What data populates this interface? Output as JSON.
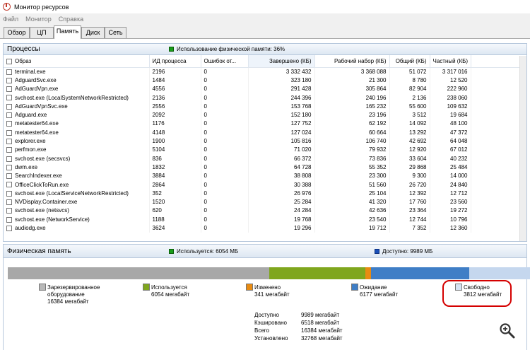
{
  "window": {
    "title": "Монитор ресурсов"
  },
  "menu": [
    "Файл",
    "Монитор",
    "Справка"
  ],
  "tabs": [
    "Обзор",
    "ЦП",
    "Память",
    "Диск",
    "Сеть"
  ],
  "processes": {
    "title": "Процессы",
    "usage_label": "Использование физической памяти: 36%",
    "columns": [
      "Образ",
      "ИД процесса",
      "Ошибок от...",
      "Завершено (КБ)",
      "Рабочий набор (КБ)",
      "Общий (КБ)",
      "Частный (КБ)"
    ],
    "rows": [
      [
        "terminal.exe",
        "2196",
        "0",
        "3 332 432",
        "3 368 088",
        "51 072",
        "3 317 016"
      ],
      [
        "AdguardSvc.exe",
        "1484",
        "0",
        "323 180",
        "21 300",
        "8 780",
        "12 520"
      ],
      [
        "AdGuardVpn.exe",
        "4556",
        "0",
        "291 428",
        "305 864",
        "82 904",
        "222 960"
      ],
      [
        "svchost.exe (LocalSystemNetworkRestricted)",
        "2136",
        "0",
        "244 396",
        "240 196",
        "2 136",
        "238 060"
      ],
      [
        "AdGuardVpnSvc.exe",
        "2556",
        "0",
        "153 768",
        "165 232",
        "55 600",
        "109 632"
      ],
      [
        "Adguard.exe",
        "2092",
        "0",
        "152 180",
        "23 196",
        "3 512",
        "19 684"
      ],
      [
        "metatester64.exe",
        "1176",
        "0",
        "127 752",
        "62 192",
        "14 092",
        "48 100"
      ],
      [
        "metatester64.exe",
        "4148",
        "0",
        "127 024",
        "60 664",
        "13 292",
        "47 372"
      ],
      [
        "explorer.exe",
        "1900",
        "0",
        "105 816",
        "106 740",
        "42 692",
        "64 048"
      ],
      [
        "perfmon.exe",
        "5104",
        "0",
        "71 020",
        "79 932",
        "12 920",
        "67 012"
      ],
      [
        "svchost.exe (secsvcs)",
        "836",
        "0",
        "66 372",
        "73 836",
        "33 604",
        "40 232"
      ],
      [
        "dwm.exe",
        "1832",
        "0",
        "64 728",
        "55 352",
        "29 868",
        "25 484"
      ],
      [
        "SearchIndexer.exe",
        "3884",
        "0",
        "38 808",
        "23 300",
        "9 300",
        "14 000"
      ],
      [
        "OfficeClickToRun.exe",
        "2864",
        "0",
        "30 388",
        "51 560",
        "26 720",
        "24 840"
      ],
      [
        "svchost.exe (LocalServiceNetworkRestricted)",
        "352",
        "0",
        "26 976",
        "25 104",
        "12 392",
        "12 712"
      ],
      [
        "NVDisplay.Container.exe",
        "1520",
        "0",
        "25 284",
        "41 320",
        "17 760",
        "23 560"
      ],
      [
        "svchost.exe (netsvcs)",
        "620",
        "0",
        "24 284",
        "42 636",
        "23 364",
        "19 272"
      ],
      [
        "svchost.exe (NetworkService)",
        "1188",
        "0",
        "19 768",
        "23 540",
        "12 744",
        "10 796"
      ],
      [
        "audiodg.exe",
        "3624",
        "0",
        "19 296",
        "19 712",
        "7 352",
        "12 360"
      ]
    ]
  },
  "physical": {
    "title": "Физическая память",
    "used_label": "Используется: 6054 МБ",
    "available_label": "Доступно: 9989 МБ",
    "bar": [
      {
        "name": "reserved",
        "value": 16384,
        "color": "#a8a8a8"
      },
      {
        "name": "used",
        "value": 6054,
        "color": "#7fa61e"
      },
      {
        "name": "modified",
        "value": 341,
        "color": "#e88b12"
      },
      {
        "name": "standby",
        "value": 6177,
        "color": "#3f7ec6"
      },
      {
        "name": "free",
        "value": 3812,
        "color": "#c5d7ee"
      }
    ],
    "legend": [
      {
        "label": "Зарезервированное",
        "label2": "оборудование",
        "value": "16384 мегабайт",
        "color": "#b8b8b8"
      },
      {
        "label": "Используется",
        "value": "6054 мегабайт",
        "color": "#7fa61e"
      },
      {
        "label": "Изменено",
        "value": "341 мегабайт",
        "color": "#e88b12"
      },
      {
        "label": "Ожидание",
        "value": "6177 мегабайт",
        "color": "#3f7ec6"
      },
      {
        "label": "Свободно",
        "value": "3812 мегабайт",
        "color": "#d6e3f3"
      }
    ],
    "stats": [
      {
        "k": "Доступно",
        "v": "9989 мегабайт"
      },
      {
        "k": "Кэшировано",
        "v": "6518 мегабайт"
      },
      {
        "k": "Всего",
        "v": "16384 мегабайт"
      },
      {
        "k": "Установлено",
        "v": "32768 мегабайт"
      }
    ]
  }
}
